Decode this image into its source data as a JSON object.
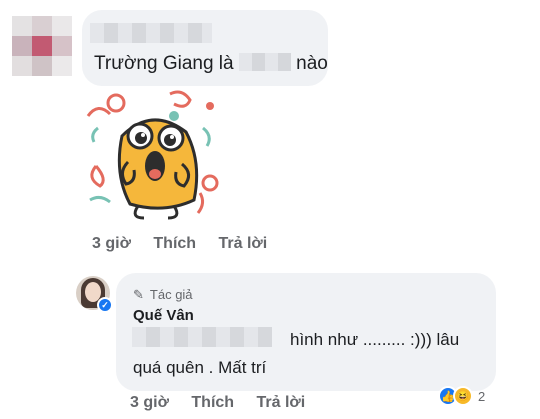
{
  "comment1": {
    "message_prefix": "Trường Giang là",
    "message_suffix": "nào",
    "sticker_icon": "surprised-potato-sticker",
    "actions": {
      "time": "3 giờ",
      "like": "Thích",
      "reply": "Trả lời"
    }
  },
  "comment2": {
    "author_badge": "Tác giả",
    "author_name": "Quế Vân",
    "message_line1": "hình như ......... :)))  lâu",
    "message_line2": "quá quên . Mất trí",
    "actions": {
      "time": "3 giờ",
      "like": "Thích",
      "reply": "Trả lời"
    },
    "reactions": {
      "icons": [
        "like-icon",
        "haha-icon"
      ],
      "count": "2"
    }
  },
  "colors": {
    "bubble": "#f0f2f5",
    "secondary_text": "#65676b",
    "like_blue": "#1877f2",
    "haha_yellow": "#f7b928"
  }
}
